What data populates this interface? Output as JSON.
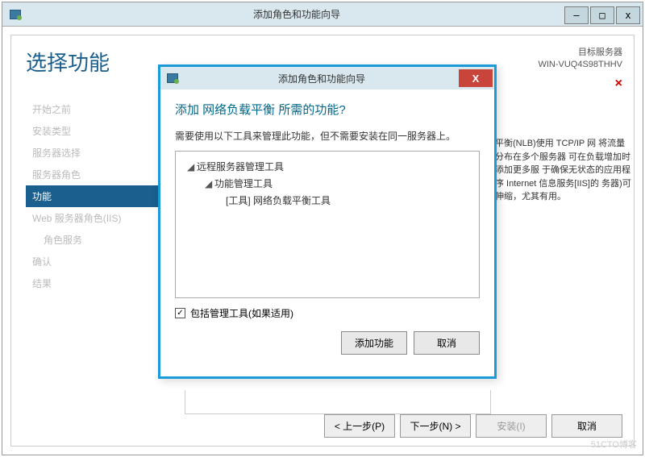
{
  "outer": {
    "title": "添加角色和功能向导",
    "min": "—",
    "max": "□",
    "close": "x"
  },
  "page": {
    "title": "选择功能",
    "target_label": "目标服务器",
    "server_name": "WIN-VUQ4S98THHV",
    "red_x": "×"
  },
  "sidebar": {
    "items": [
      {
        "label": "开始之前"
      },
      {
        "label": "安装类型"
      },
      {
        "label": "服务器选择"
      },
      {
        "label": "服务器角色"
      },
      {
        "label": "功能",
        "selected": true
      },
      {
        "label": "Web 服务器角色(IIS)"
      },
      {
        "label": "角色服务",
        "sub": true
      },
      {
        "label": "确认"
      },
      {
        "label": "结果"
      }
    ]
  },
  "desc": {
    "text": "平衡(NLB)使用 TCP/IP 网 将流量分布在多个服务器 可在负载增加时添加更多服 于确保无状态的应用程序 Internet 信息服务[IIS]的 务器)可伸缩，尤其有用。"
  },
  "buttons": {
    "prev": "< 上一步(P)",
    "next": "下一步(N) >",
    "install": "安装(I)",
    "cancel": "取消"
  },
  "modal": {
    "title": "添加角色和功能向导",
    "close": "X",
    "heading": "添加 网络负载平衡 所需的功能?",
    "text": "需要使用以下工具来管理此功能，但不需要安装在同一服务器上。",
    "tree": {
      "n1": "远程服务器管理工具",
      "n2": "功能管理工具",
      "n3": "[工具] 网络负载平衡工具"
    },
    "arrow": "◢",
    "checkbox_checked": "✓",
    "checkbox_label": "包括管理工具(如果适用)",
    "add": "添加功能",
    "cancel": "取消"
  },
  "watermark": "51CTO博客"
}
